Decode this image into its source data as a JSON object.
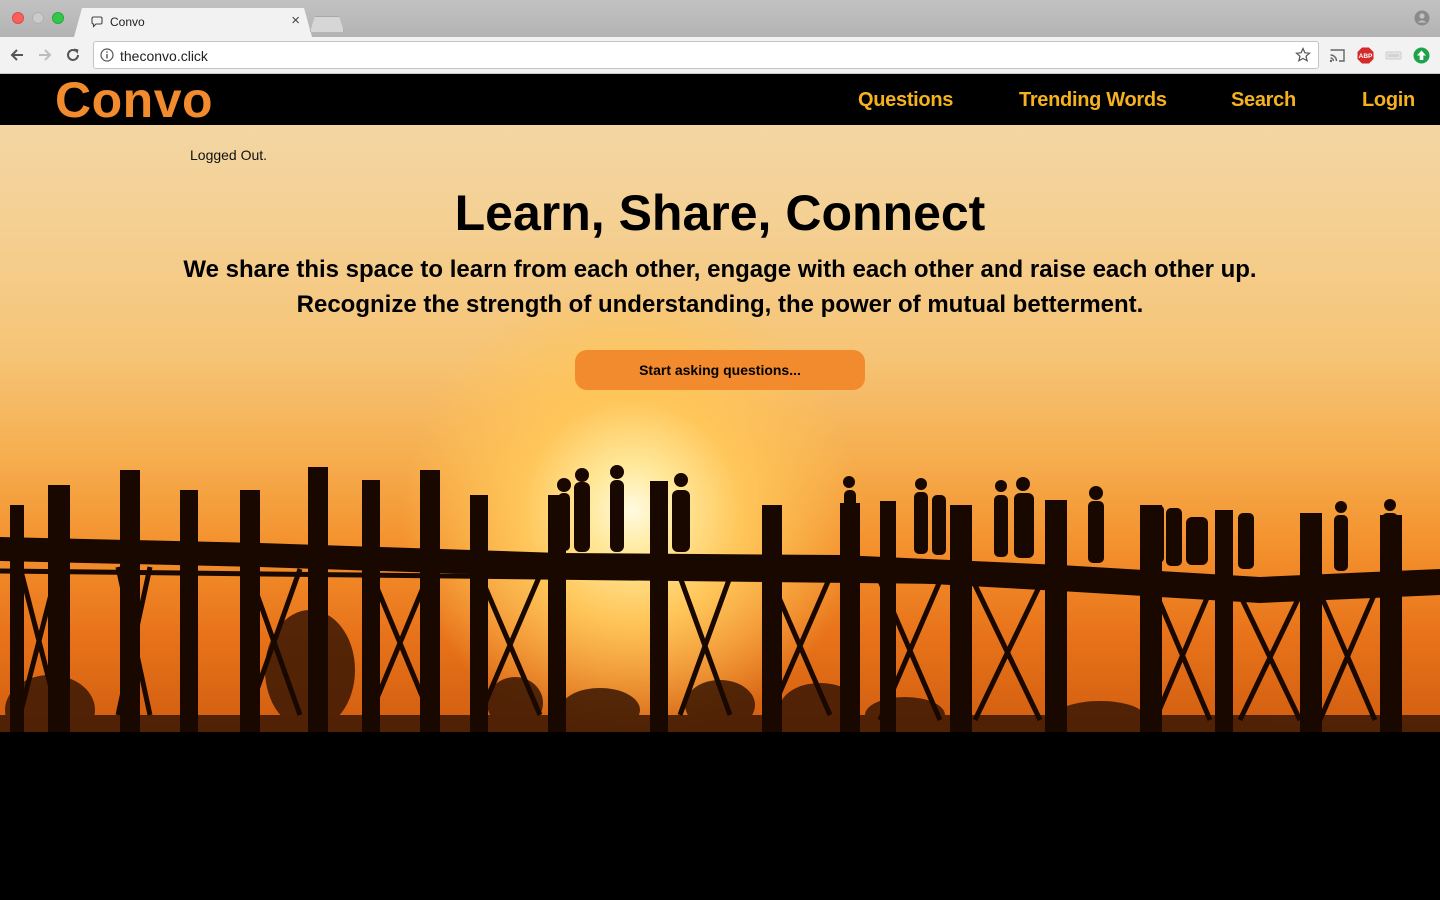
{
  "browser": {
    "tab_title": "Convo",
    "tab_close": "×",
    "url": "theconvo.click"
  },
  "site": {
    "logo": "Convo",
    "nav": [
      "Questions",
      "Trending Words",
      "Search",
      "Login"
    ]
  },
  "hero": {
    "status": "Logged Out.",
    "headline": "Learn, Share, Connect",
    "tagline_line1": "We share this space to learn from each other, engage with each other and raise each other up.",
    "tagline_line2": "Recognize the strength of understanding, the power of mutual betterment.",
    "cta_label": "Start asking questions..."
  },
  "colors": {
    "brand_orange": "#f28a2e",
    "nav_gold": "#f5b21e",
    "nav_background": "#000000"
  },
  "icons": [
    "back-icon",
    "forward-icon",
    "reload-icon",
    "info-icon",
    "bookmark-star-icon",
    "cast-icon",
    "adblock-icon",
    "extension-icon",
    "update-icon",
    "profile-icon",
    "chat-bubble-icon"
  ]
}
